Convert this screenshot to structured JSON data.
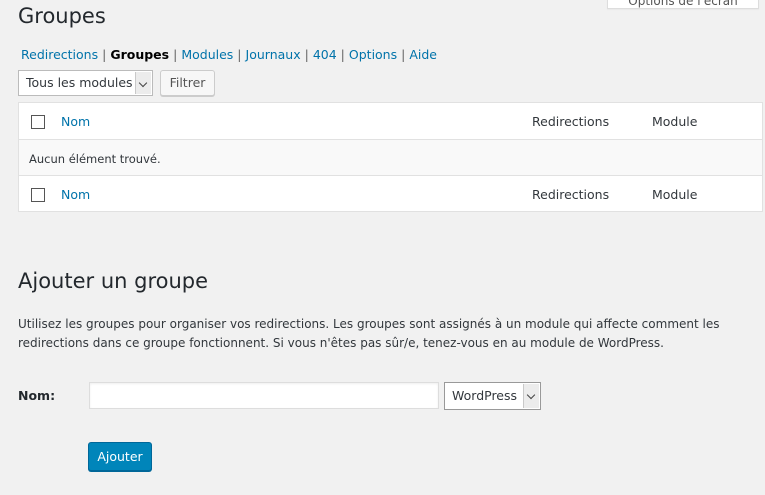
{
  "screen_options": {
    "label": "Options de l'écran"
  },
  "page_title": "Groupes",
  "subnav": [
    {
      "label": "Redirections",
      "current": false
    },
    {
      "label": "Groupes",
      "current": true
    },
    {
      "label": "Modules",
      "current": false
    },
    {
      "label": "Journaux",
      "current": false
    },
    {
      "label": "404",
      "current": false
    },
    {
      "label": "Options",
      "current": false
    },
    {
      "label": "Aide",
      "current": false
    }
  ],
  "filter": {
    "module_select_value": "Tous les modules",
    "filter_button": "Filtrer"
  },
  "table": {
    "columns": {
      "name": "Nom",
      "redirections": "Redirections",
      "module": "Module"
    },
    "empty_message": "Aucun élément trouvé."
  },
  "add_group": {
    "title": "Ajouter un groupe",
    "description": "Utilisez les groupes pour organiser vos redirections. Les groupes sont assignés à un module qui affecte comment les redirections dans ce groupe fonctionnent. Si vous n'êtes pas sûr/e, tenez-vous en au module de WordPress.",
    "name_label": "Nom:",
    "name_value": "",
    "module_select_value": "WordPress",
    "submit_button": "Ajouter"
  },
  "colors": {
    "link": "#0073aa",
    "primary_button": "#0085ba",
    "background": "#f1f1f1"
  }
}
